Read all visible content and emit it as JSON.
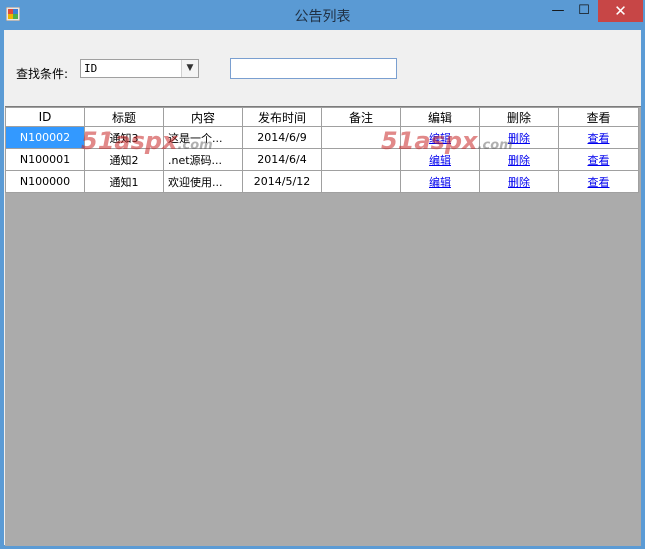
{
  "window": {
    "title": "公告列表",
    "min_symbol": "—",
    "max_symbol": "☐",
    "close_symbol": "✕"
  },
  "filter": {
    "label": "查找条件:",
    "selected_option": "ID",
    "search_value": ""
  },
  "grid": {
    "columns": [
      "ID",
      "标题",
      "内容",
      "发布时间",
      "备注",
      "编辑",
      "删除",
      "查看"
    ],
    "rows": [
      {
        "id": "N100002",
        "title": "通知3",
        "content": "这是一个...",
        "date": "2014/6/9",
        "note": "",
        "edit": "编辑",
        "delete": "删除",
        "view": "查看"
      },
      {
        "id": "N100001",
        "title": "通知2",
        "content": ".net源码...",
        "date": "2014/6/4",
        "note": "",
        "edit": "编辑",
        "delete": "删除",
        "view": "查看"
      },
      {
        "id": "N100000",
        "title": "通知1",
        "content": "欢迎使用...",
        "date": "2014/5/12",
        "note": "",
        "edit": "编辑",
        "delete": "删除",
        "view": "查看"
      }
    ]
  },
  "watermark": {
    "text": "51aspx",
    "suffix": ".com"
  },
  "colors": {
    "titlebar": "#5a9ad4",
    "close_button": "#c74646",
    "selected_cell": "#3399ff",
    "grid_background": "#ababab",
    "link": "#0000ee"
  }
}
